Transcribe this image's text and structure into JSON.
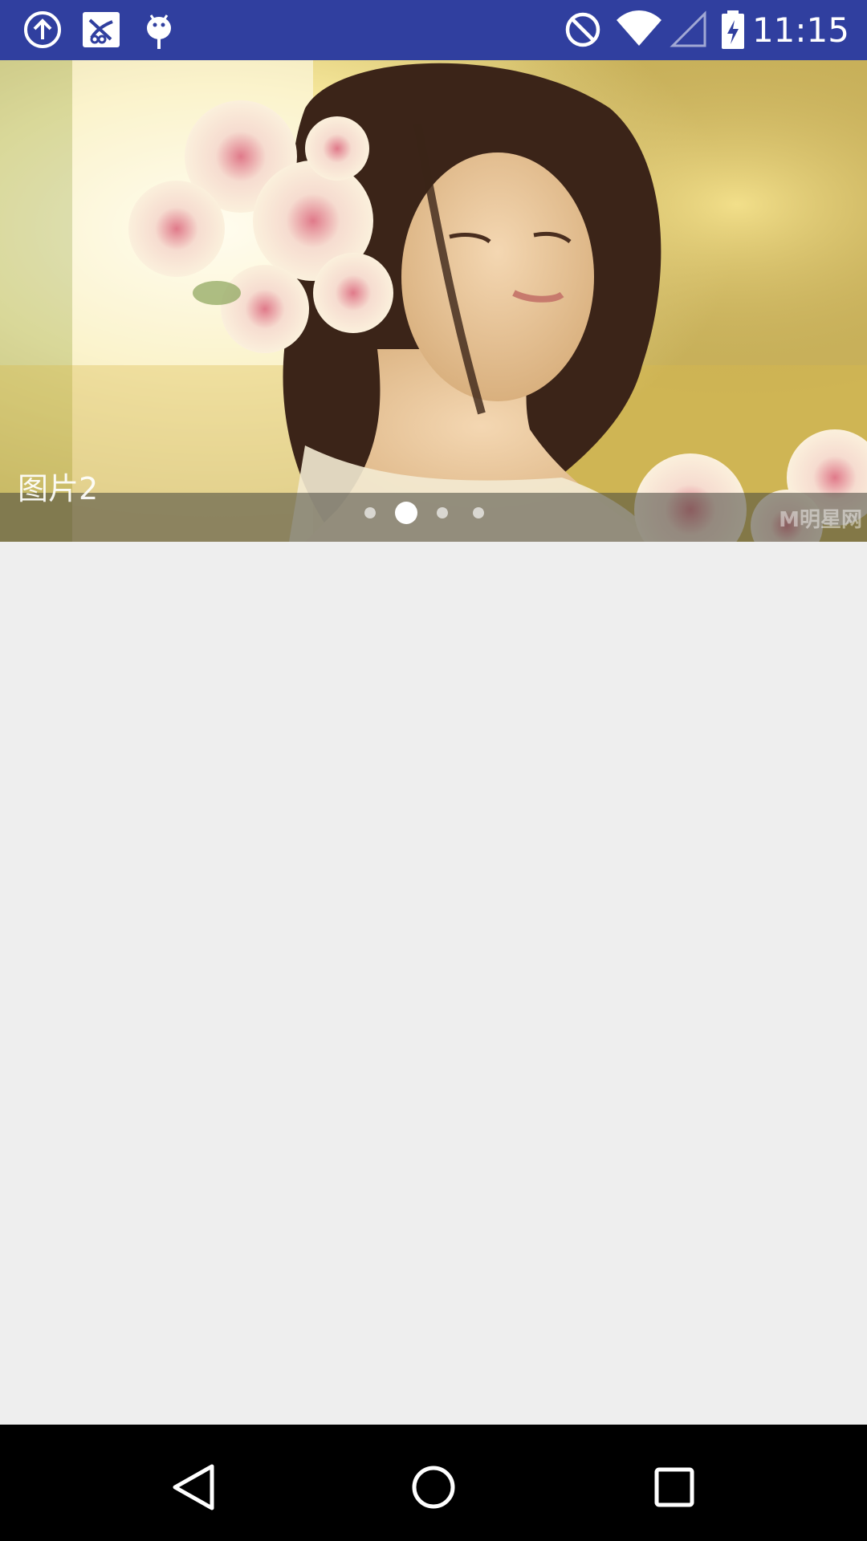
{
  "status_bar": {
    "time": "11:15",
    "background_color": "#303f9f",
    "left_icons": [
      "upload-icon",
      "app-notification-icon",
      "android-debug-icon"
    ],
    "right_icons": [
      "do-not-disturb-icon",
      "wifi-icon",
      "cell-signal-icon",
      "battery-charging-icon"
    ]
  },
  "banner": {
    "caption": "图片2",
    "page_count": 4,
    "active_page_index": 1,
    "watermark": "M明星网"
  },
  "nav_bar": {
    "buttons": [
      "back-icon",
      "home-icon",
      "recents-icon"
    ]
  }
}
